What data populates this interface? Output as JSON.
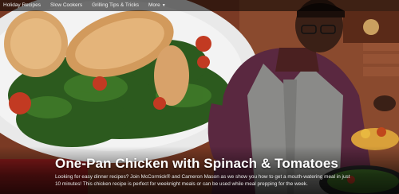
{
  "nav": {
    "items": [
      {
        "label": "Holiday Recipes"
      },
      {
        "label": "Slow Cookers"
      },
      {
        "label": "Grilling Tips & Tricks"
      },
      {
        "label": "More"
      }
    ]
  },
  "hero": {
    "title": "One-Pan Chicken with Spinach & Tomatoes",
    "description": "Looking for easy dinner recipes? Join McCormick® and Cameron Mason as we show you how to get a mouth-watering meal in just 10 minutes! This chicken recipe is perfect for weeknight meals or can be used while meal prepping for the week."
  },
  "colors": {
    "nav_bg": "#000000",
    "title_text": "#ffffff",
    "shirt": "#5a2840",
    "vest": "#8a8a88",
    "spinach": "#2c5a1e",
    "chicken": "#d8a56a",
    "pan": "#e9e9e9"
  },
  "icons": {
    "more_caret": "chevron-down-icon"
  }
}
